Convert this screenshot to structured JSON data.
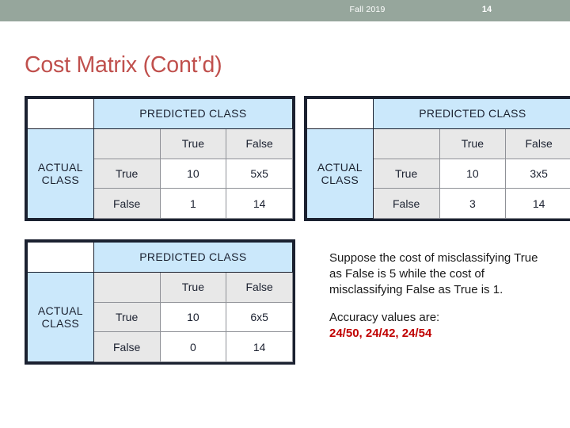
{
  "header": {
    "term": "Fall 2019",
    "slide_number": "14",
    "band_color": "#96a69c"
  },
  "title": {
    "text": "Cost Matrix (Cont’d)",
    "color": "#c0504d"
  },
  "colors": {
    "table_border": "#1b2130",
    "header_fill": "#cbe8fb",
    "label_fill": "#e8e8e8",
    "value_fill": "#ffffff",
    "accent_red": "#c00000",
    "title_red": "#c0504d"
  },
  "labels": {
    "predicted_class": "PREDICTED CLASS",
    "actual_class": "ACTUAL CLASS",
    "actual_class_line1": "ACTUAL",
    "actual_class_line2": "CLASS",
    "true": "True",
    "false": "False"
  },
  "matrices": [
    {
      "id": "matrix-1",
      "col_header": "PREDICTED CLASS",
      "row_header": "ACTUAL CLASS",
      "columns": [
        "True",
        "False"
      ],
      "rows": [
        "True",
        "False"
      ],
      "cells": [
        [
          "10",
          "5x5"
        ],
        [
          "1",
          "14"
        ]
      ]
    },
    {
      "id": "matrix-2",
      "col_header": "PREDICTED CLASS",
      "row_header": "ACTUAL CLASS",
      "columns": [
        "True",
        "False"
      ],
      "rows": [
        "True",
        "False"
      ],
      "cells": [
        [
          "10",
          "3x5"
        ],
        [
          "3",
          "14"
        ]
      ]
    },
    {
      "id": "matrix-3",
      "col_header": "PREDICTED CLASS",
      "row_header": "ACTUAL CLASS",
      "columns": [
        "True",
        "False"
      ],
      "rows": [
        "True",
        "False"
      ],
      "cells": [
        [
          "10",
          "6x5"
        ],
        [
          "0",
          "14"
        ]
      ]
    }
  ],
  "note": {
    "paragraph": "Suppose the cost of misclassifying True as False is 5 while the cost of misclassifying False as True is 1.",
    "accuracy_label": "Accuracy values are:",
    "accuracy_values": "24/50, 24/42, 24/54"
  }
}
